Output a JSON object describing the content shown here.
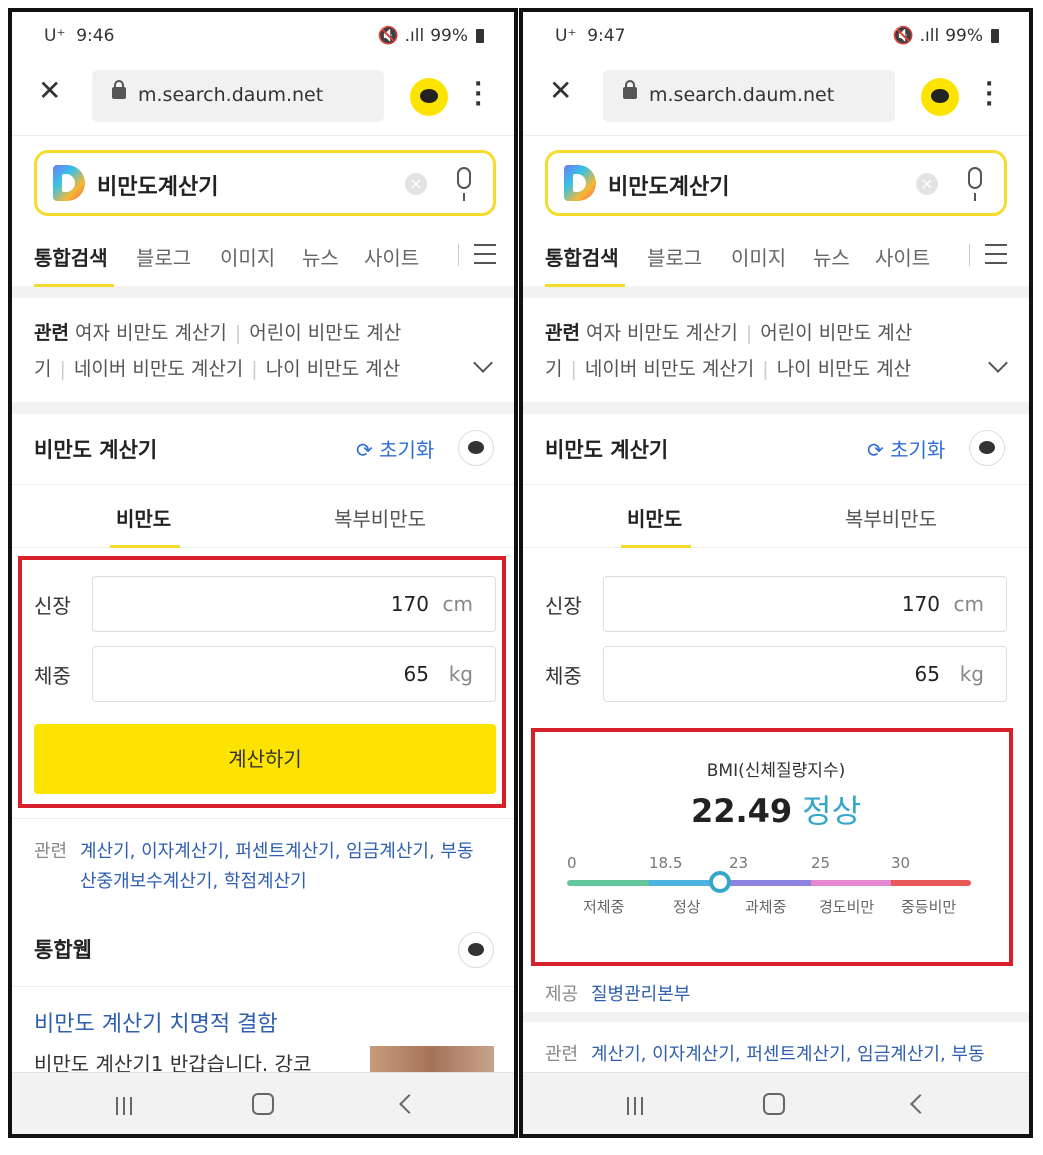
{
  "left": {
    "status": {
      "time": "9:46",
      "battery": "99%",
      "carrier": "U⁺"
    },
    "url": "m.search.daum.net",
    "query": "비만도계산기",
    "tabs": [
      "통합검색",
      "블로그",
      "이미지",
      "뉴스",
      "사이트"
    ],
    "related_keywords": {
      "label": "관련",
      "line1": [
        "여자 비만도 계산기",
        "어린이 비만도 계산"
      ],
      "line2": [
        "기",
        "네이버 비만도 계산기",
        "나이 비만도 계산"
      ]
    },
    "calculator": {
      "title": "비만도 계산기",
      "reset": "초기화",
      "tab_bmi": "비만도",
      "tab_abdominal": "복부비만도",
      "height_label": "신장",
      "height_value": "170",
      "height_unit": "cm",
      "weight_label": "체중",
      "weight_value": "65",
      "weight_unit": "kg",
      "button": "계산하기"
    },
    "related_links": {
      "label": "관련",
      "line1": "계산기, 이자계산기, 퍼센트계산기, 임금계산기, 부동",
      "line2": "산중개보수계산기, 학점계산기"
    },
    "web": {
      "title": "통합웹",
      "headline": "비만도 계산기 치명적 결함",
      "snippet": "비만도 계산기1 반갑습니다. 강코"
    }
  },
  "right": {
    "status": {
      "time": "9:47",
      "battery": "99%",
      "carrier": "U⁺"
    },
    "url": "m.search.daum.net",
    "query": "비만도계산기",
    "tabs": [
      "통합검색",
      "블로그",
      "이미지",
      "뉴스",
      "사이트"
    ],
    "related_keywords": {
      "label": "관련",
      "line1": [
        "여자 비만도 계산기",
        "어린이 비만도 계산"
      ],
      "line2": [
        "기",
        "네이버 비만도 계산기",
        "나이 비만도 계산"
      ]
    },
    "calculator": {
      "title": "비만도 계산기",
      "reset": "초기화",
      "tab_bmi": "비만도",
      "tab_abdominal": "복부비만도",
      "height_label": "신장",
      "height_value": "170",
      "height_unit": "cm",
      "weight_label": "체중",
      "weight_value": "65",
      "weight_unit": "kg"
    },
    "result": {
      "label": "BMI(신체질량지수)",
      "value": "22.49",
      "status": "정상",
      "scale_numbers": [
        "0",
        "18.5",
        "23",
        "25",
        "30"
      ],
      "categories": [
        "저체중",
        "정상",
        "과체중",
        "경도비만",
        "중등비만"
      ],
      "segment_colors": [
        "#62c69a",
        "#4cb3e0",
        "#8d83e0",
        "#e58ad0",
        "#e85a5a"
      ],
      "marker_bmi": 22.49
    },
    "provider": {
      "label": "제공",
      "source": "질병관리본부"
    },
    "related_links": {
      "label": "관련",
      "line1": "계산기, 이자계산기, 퍼센트계산기, 임금계산기, 부동"
    }
  },
  "highlight_color": "#d6202a",
  "accent_yellow": "#fde400"
}
